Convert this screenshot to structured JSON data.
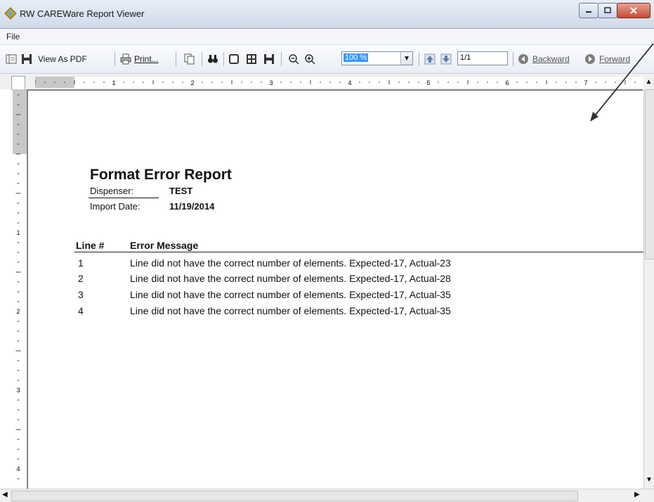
{
  "window": {
    "title": "RW CAREWare Report Viewer",
    "icon": "careware-logo-icon"
  },
  "menu": {
    "items": [
      "File"
    ]
  },
  "toolbar": {
    "view_as_pdf": "View As PDF",
    "print": "Print...",
    "zoom": "100 %",
    "page": "1/1",
    "backward": "Backward",
    "forward": "Forward"
  },
  "ruler": {
    "horizontal_marks": [
      "1",
      "2",
      "3",
      "4",
      "5",
      "6",
      "7"
    ],
    "vertical_marks": [
      "1",
      "2",
      "3",
      "4"
    ]
  },
  "report": {
    "title": "Format Error Report",
    "dispenser_label": "Dispenser:",
    "dispenser_value": "TEST",
    "import_date_label": "Import Date:",
    "import_date_value": "11/19/2014",
    "columns": [
      "Line #",
      "Error Message"
    ],
    "rows": [
      {
        "line": "1",
        "message": "Line did not have the correct number of elements. Expected-17, Actual-23"
      },
      {
        "line": "2",
        "message": "Line did not have the correct number of elements. Expected-17, Actual-28"
      },
      {
        "line": "3",
        "message": "Line did not have the correct number of elements. Expected-17, Actual-35"
      },
      {
        "line": "4",
        "message": "Line did not have the correct number of elements. Expected-17, Actual-35"
      }
    ]
  },
  "colors": {
    "zoom_highlight": "#3399ff",
    "close_button": "#c74b36",
    "annotation_arrow": "#333333"
  }
}
